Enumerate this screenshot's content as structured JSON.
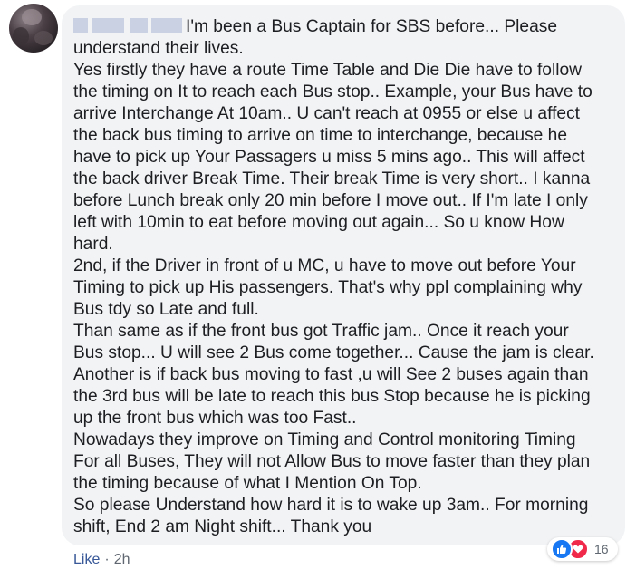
{
  "comment": {
    "lines": [
      "I'm been a Bus Captain for SBS before... Please",
      "understand their lives.",
      "Yes firstly they have a route Time Table and Die Die have to follow",
      "the timing on It to reach each Bus stop.. Example, your Bus have to",
      "arrive Interchange At 10am.. U can't reach at 0955 or else u affect",
      "the back bus timing to arrive on time to interchange, because he",
      "have to pick up Your Passagers u miss 5 mins ago.. This will affect",
      "the back driver Break Time. Their break Time is very short.. I kanna",
      "before Lunch break only 20 min before I move out.. If I'm late I only",
      "left with 10min to eat before moving out again... So u know How",
      "hard.",
      "2nd, if the Driver in front of u MC, u have to move out before Your",
      "Timing to pick up His passengers. That's why ppl complaining why",
      "Bus tdy so Late and full.",
      "Than same as if the front bus got Traffic jam.. Once it reach your",
      "Bus stop... U will see 2 Bus come together... Cause the jam is clear.",
      "Another is if back bus moving to fast ,u will See 2 buses again than",
      "the 3rd bus will be late to reach this bus Stop because he is picking",
      "up the front bus which was too Fast..",
      "Nowadays they improve on Timing and Control monitoring Timing",
      "For all Buses, They will not Allow Bus to move faster than they plan",
      "the timing because of what I Mention On Top.",
      "So please Understand how hard it is to wake up 3am.. For morning",
      "shift, End 2 am Night shift... Thank you"
    ]
  },
  "reactions": {
    "icons": [
      "like-icon",
      "love-icon"
    ],
    "count": "16",
    "like_color": "#1877f2",
    "love_color": "#f0284a"
  },
  "footer": {
    "like_label": "Like",
    "separator": "·",
    "time": "2h"
  },
  "colors": {
    "bubble_bg": "#f2f3f5",
    "link": "#385898",
    "meta_text": "#606770",
    "body_text": "#1c1e21"
  }
}
